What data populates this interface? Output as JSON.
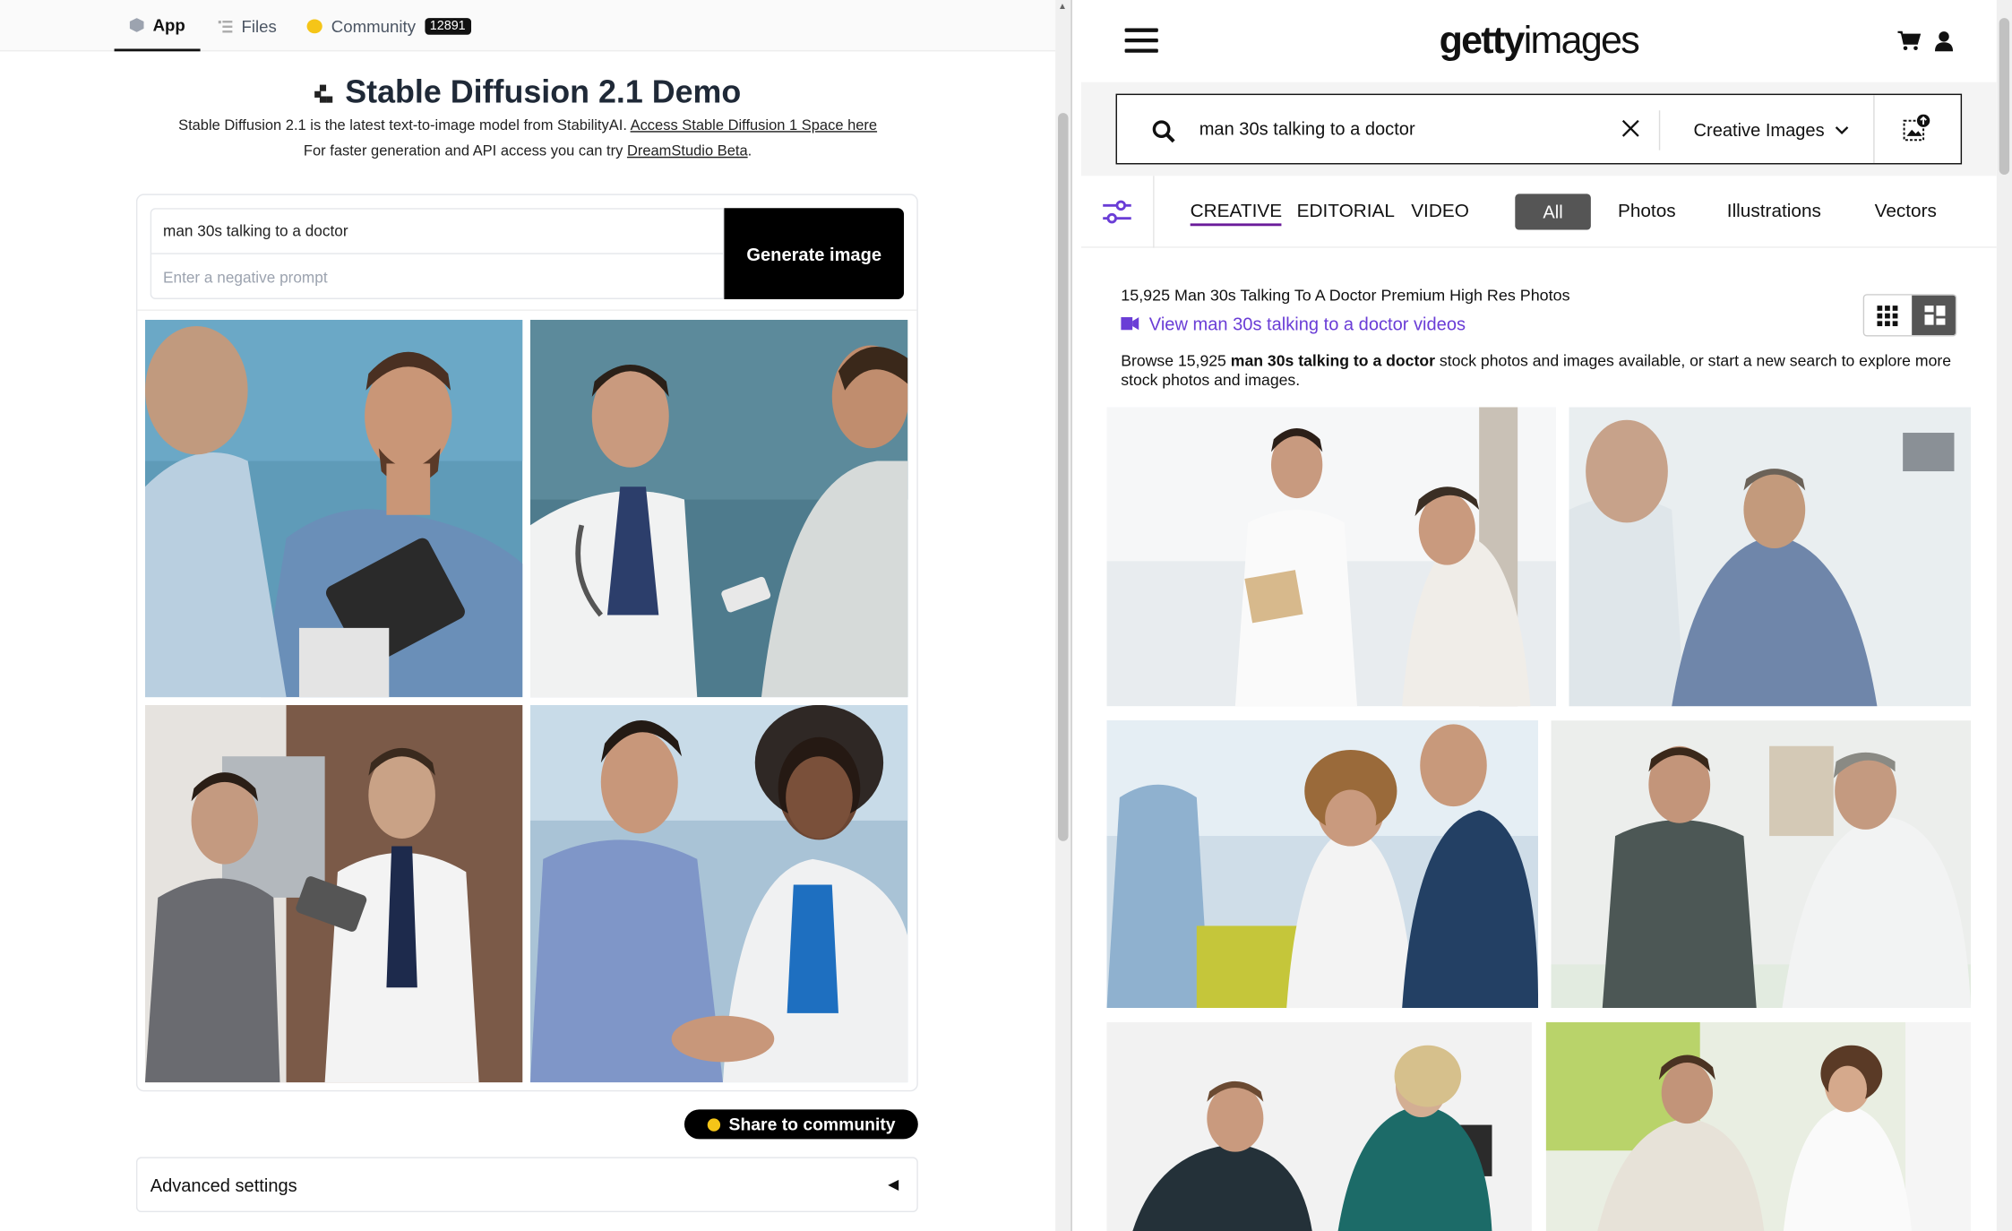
{
  "space_tabs": [
    {
      "label": "App",
      "icon": "cube-icon"
    },
    {
      "label": "Files",
      "icon": "files-icon"
    },
    {
      "label": "Community",
      "icon": "hf-emoji-icon",
      "badge": "12891"
    }
  ],
  "demo": {
    "title": "Stable Diffusion 2.1 Demo",
    "intro_line1": "Stable Diffusion 2.1 is the latest text-to-image model from StabilityAI.",
    "intro_link1": "Access Stable Diffusion 1 Space here",
    "intro_line2": "For faster generation and API access you can try",
    "intro_link2": "DreamStudio Beta",
    "intro_end": "."
  },
  "prompt": {
    "value": "man 30s talking to a doctor",
    "negative_placeholder": "Enter a negative prompt",
    "generate_label": "Generate image"
  },
  "gallery": {
    "images": [
      {
        "alt": "patient-in-blue-shirt-with-doctor-tablet"
      },
      {
        "alt": "doctor-with-stethoscope-and-man-with-phone"
      },
      {
        "alt": "man-in-sweater-with-doctor-holding-tablet"
      },
      {
        "alt": "male-doctor-and-female-doctor-talking"
      }
    ]
  },
  "share_label": "Share to community",
  "advanced_label": "Advanced settings",
  "getty": {
    "logo_bold": "getty",
    "logo_light": "images",
    "search_value": "man 30s talking to a doctor",
    "search_type": "Creative Images",
    "content_tabs": [
      "CREATIVE",
      "EDITORIAL",
      "VIDEO"
    ],
    "filter_types": [
      "All",
      "Photos",
      "Illustrations",
      "Vectors"
    ],
    "results_title": "15,925 Man 30s Talking To A Doctor Premium High Res Photos",
    "video_link": "View man 30s talking to a doctor videos",
    "browse_prefix": "Browse 15,925",
    "browse_bold": "man 30s talking to a doctor",
    "browse_suffix": "stock photos and images available, or start a new search to explore more stock photos and images.",
    "accent": "#6a3dd6",
    "photos": [
      {
        "alt": "doctor-with-clipboard-talking-to-patient"
      },
      {
        "alt": "mature-man-in-check-shirt-with-doctor"
      },
      {
        "alt": "female-doctor-with-tablet-and-bearded-patient"
      },
      {
        "alt": "doctor-hand-on-shoulder-of-patient"
      },
      {
        "alt": "nurse-and-young-man-at-desk"
      },
      {
        "alt": "female-doctor-and-man-in-clinic"
      }
    ]
  }
}
